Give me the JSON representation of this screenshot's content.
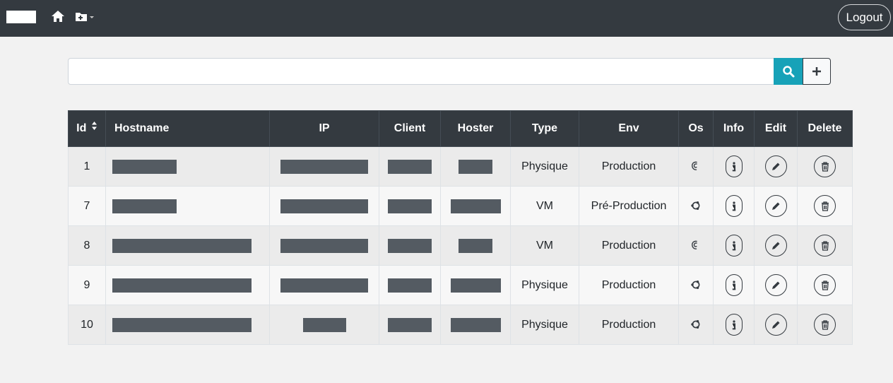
{
  "navbar": {
    "logout_label": "Logout",
    "colors": {
      "background": "#343a40",
      "text": "#ffffff"
    }
  },
  "search": {
    "placeholder": "",
    "value": ""
  },
  "table": {
    "headers": {
      "id": "Id",
      "hostname": "Hostname",
      "ip": "IP",
      "client": "Client",
      "hoster": "Hoster",
      "type": "Type",
      "env": "Env",
      "os": "Os",
      "info": "Info",
      "edit": "Edit",
      "delete": "Delete"
    },
    "rows": [
      {
        "id": "1",
        "type": "Physique",
        "env": "Production",
        "os_icon": "debian-icon"
      },
      {
        "id": "7",
        "type": "VM",
        "env": "Pré-Production",
        "os_icon": "ubuntu-icon"
      },
      {
        "id": "8",
        "type": "VM",
        "env": "Production",
        "os_icon": "debian-icon"
      },
      {
        "id": "9",
        "type": "Physique",
        "env": "Production",
        "os_icon": "ubuntu-icon"
      },
      {
        "id": "10",
        "type": "Physique",
        "env": "Production",
        "os_icon": "ubuntu-icon"
      }
    ]
  },
  "colors": {
    "accent": "#17a2b8",
    "redaction": "#545b62"
  }
}
